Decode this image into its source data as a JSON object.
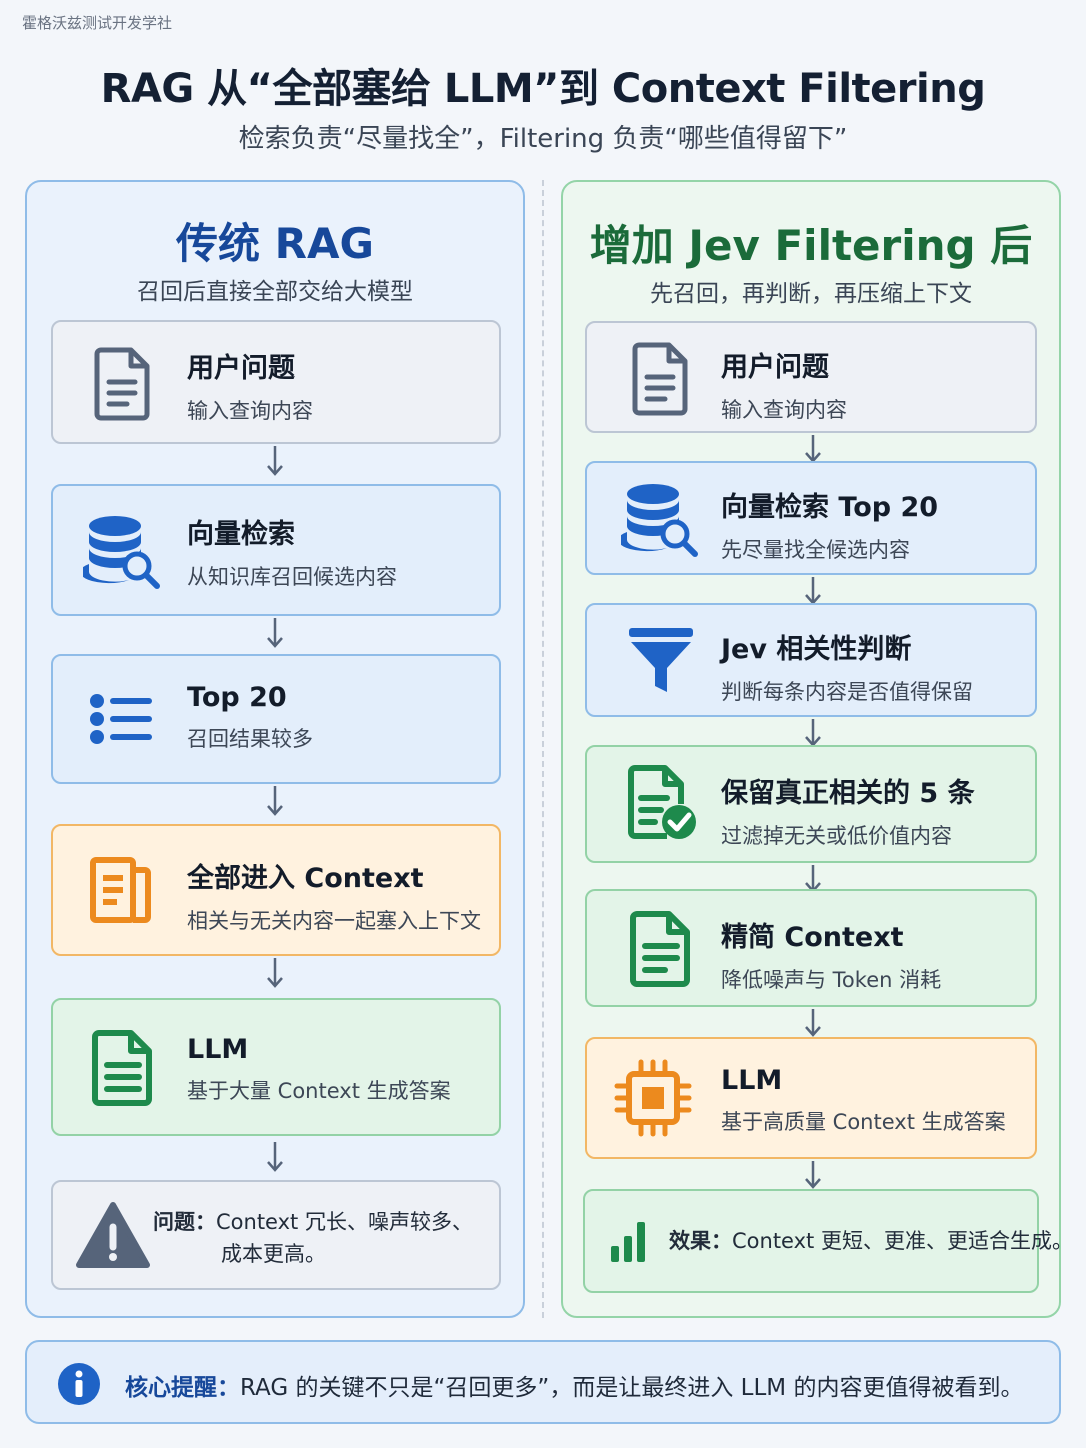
{
  "watermark": "霍格沃兹测试开发学社",
  "title": "RAG 从“全部塞给 LLM”到 Context Filtering",
  "subtitle": "检索负责“尽量找全”，Filtering 负责“哪些值得留下”",
  "left": {
    "title": "传统 RAG",
    "subtitle": "召回后直接全部交给大模型",
    "steps": [
      {
        "label": "用户问题",
        "desc": "输入查询内容",
        "icon": "document-icon"
      },
      {
        "label": "向量检索",
        "desc": "从知识库召回候选内容",
        "icon": "database-search-icon"
      },
      {
        "label": "Top 20",
        "desc": "召回结果较多",
        "icon": "list-icon"
      },
      {
        "label": "全部进入 Context",
        "desc": "相关与无关内容一起塞入上下文",
        "icon": "documents-icon"
      },
      {
        "label": "LLM",
        "desc": "基于大量 Context 生成答案",
        "icon": "document-icon"
      }
    ],
    "note": {
      "key": "问题：",
      "line1": "Context 冗长、噪声较多、",
      "line2": "成本更高。",
      "icon": "warning-icon"
    }
  },
  "right": {
    "title": "增加 Jev Filtering 后",
    "subtitle": "先召回，再判断，再压缩上下文",
    "steps": [
      {
        "label": "用户问题",
        "desc": "输入查询内容",
        "icon": "document-icon"
      },
      {
        "label": "向量检索 Top 20",
        "desc": "先尽量找全候选内容",
        "icon": "database-search-icon"
      },
      {
        "label": "Jev 相关性判断",
        "desc": "判断每条内容是否值得保留",
        "icon": "funnel-icon"
      },
      {
        "label": "保留真正相关的 5 条",
        "desc": "过滤掉无关或低价值内容",
        "icon": "document-check-icon"
      },
      {
        "label": "精简 Context",
        "desc": "降低噪声与 Token 消耗",
        "icon": "document-icon"
      },
      {
        "label": "LLM",
        "desc": "基于高质量 Context 生成答案",
        "icon": "chip-icon"
      }
    ],
    "note": {
      "key": "效果：",
      "text": "Context 更短、更准、更适合生成。",
      "icon": "bar-chart-icon"
    }
  },
  "tip": {
    "key": "核心提醒：",
    "text": "RAG 的关键不只是“召回更多”，而是让最终进入 LLM 的内容更值得被看到。",
    "icon": "info-icon"
  },
  "colors": {
    "blue": "#1f63c6",
    "green": "#1e8a4c",
    "orange": "#ec8a1e",
    "gray": "#56647a"
  }
}
